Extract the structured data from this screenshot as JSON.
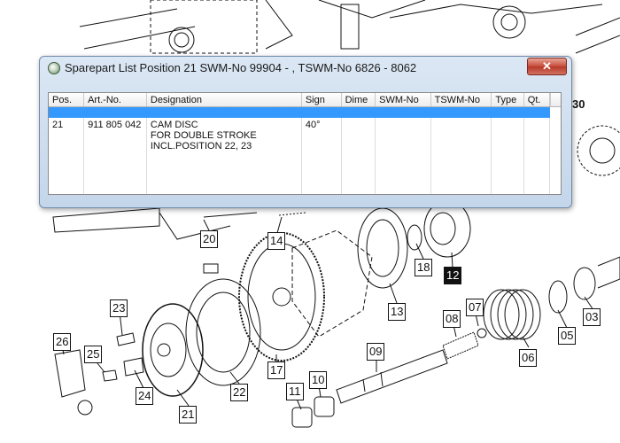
{
  "window": {
    "title": "Sparepart List Position 21 SWM-No 99904 - , TSWM-No 6826 - 8062",
    "close_label": "✕",
    "icon": "globe-app-icon"
  },
  "table": {
    "columns": [
      "Pos.",
      "Art.-No.",
      "Designation",
      "Sign",
      "Dime",
      "SWM-No",
      "TSWM-No",
      "Type",
      "Qt."
    ],
    "rows": [
      {
        "pos": "21",
        "art_no": "911 805 042",
        "designation": [
          "CAM DISC",
          "FOR DOUBLE STROKE",
          "INCL.POSITION 22, 23"
        ],
        "sign": "40°",
        "dime": "",
        "swm_no": "",
        "tswm_no": "",
        "type": "",
        "qt": ""
      }
    ]
  },
  "callouts": [
    "30",
    "20",
    "14",
    "18",
    "12",
    "13",
    "08",
    "07",
    "23",
    "26",
    "25",
    "24",
    "21",
    "22",
    "17",
    "09",
    "11",
    "10",
    "05",
    "06",
    "03"
  ],
  "colors": {
    "selection": "#3399ff",
    "close_button": "#c74c3a",
    "highlight_callout": "#111111"
  }
}
